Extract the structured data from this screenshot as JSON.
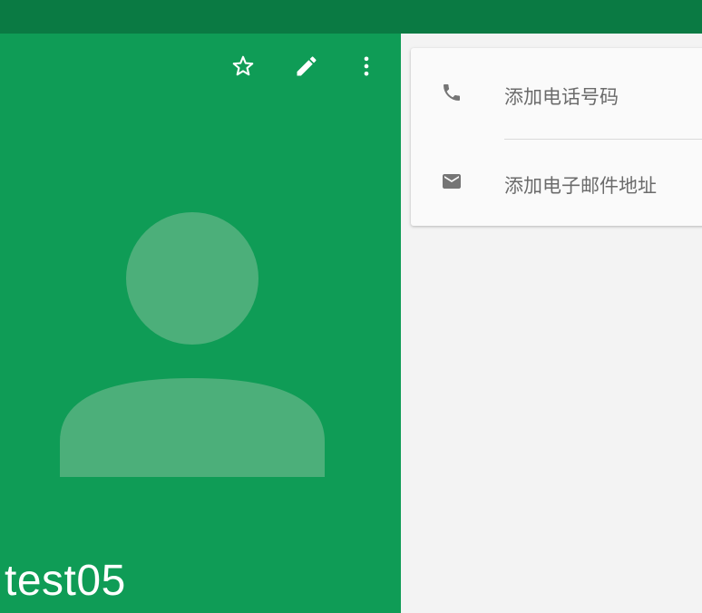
{
  "contact": {
    "name": "test05"
  },
  "toolbar": {
    "star_icon": "star-outline-icon",
    "edit_icon": "pencil-icon",
    "more_icon": "more-vert-icon"
  },
  "details": {
    "phone_label": "添加电话号码",
    "email_label": "添加电子邮件地址"
  },
  "colors": {
    "status_bar": "#0a7a43",
    "header_green": "#0f9c56",
    "avatar_silhouette": "#4caf7a",
    "panel_background": "#f3f3f3",
    "card_background": "#fafafa",
    "label_text": "#6b6b6b",
    "icon_gray": "#757575"
  }
}
